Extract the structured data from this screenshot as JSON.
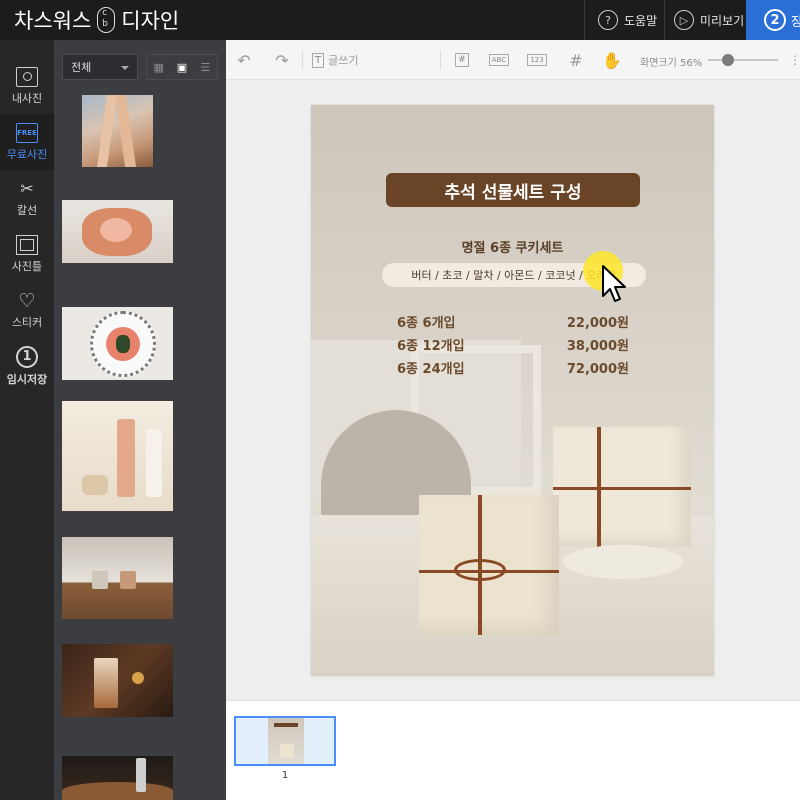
{
  "app": {
    "brand_left": "차스워스",
    "brand_right": "디자인"
  },
  "header": {
    "help_label": "도움말",
    "help_icon": "question-circle-icon",
    "preview_label": "미리보기",
    "preview_icon": "play-circle-icon",
    "step_number": "2",
    "step_label": "장"
  },
  "sidebar": {
    "items": [
      {
        "label": "내사진",
        "icon": "photo-icon"
      },
      {
        "label": "무료사진",
        "icon": "free-photo-icon",
        "badge": "FREE"
      },
      {
        "label": "칼선",
        "icon": "scissors-icon"
      },
      {
        "label": "사진틀",
        "icon": "frame-icon"
      },
      {
        "label": "스티커",
        "icon": "heart-icon"
      },
      {
        "label": "임시저장",
        "icon": "number-one-icon",
        "icon_text": "1"
      }
    ]
  },
  "panel": {
    "filter_value": "전체"
  },
  "toolbar": {
    "text_button_label": "글쓰기",
    "zoom_label": "화면크기 56%",
    "zoom_percent": 56,
    "abc_label": "ABC",
    "num_label": "123"
  },
  "design": {
    "title": "추석 선물세트 구성",
    "subtitle": "명절 6종 쿠키세트",
    "flavors": "버터 / 초코 / 말차 / 아몬드 / 코코넛 / 오레오",
    "prices": [
      {
        "label": "6종 6개입",
        "amount": "22,000원"
      },
      {
        "label": "6종 12개입",
        "amount": "38,000원"
      },
      {
        "label": "6종 24개입",
        "amount": "72,000원"
      }
    ]
  },
  "pages": {
    "current_page": "1"
  },
  "colors": {
    "topbar": "#1c1c1c",
    "accent": "#2a6fd6",
    "panel": "#3b3d40",
    "banner": "#6a4426",
    "cursor_highlight": "#ffe628"
  }
}
